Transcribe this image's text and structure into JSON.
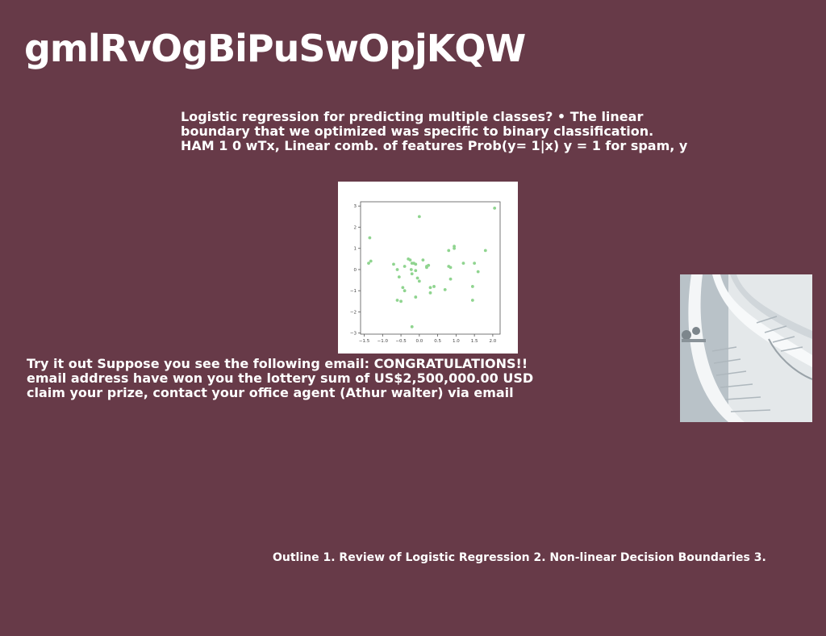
{
  "slide": {
    "title": "gmlRvOgBiPuSwOpjKQW",
    "paragraph_a": [
      "Logistic regression for predicting multiple classes? • The linear",
      "boundary that we optimized was specific to binary classification.",
      "HAM 1 0 wTx, Linear comb. of features Prob(y= 1|x) y = 1 for spam, y"
    ],
    "paragraph_b": [
      "Try it out Suppose you see the following email: CONGRATULATIONS!!",
      "email address have won you the lottery sum of US$2,500,000.00 USD",
      "claim your prize, contact your office agent (Athur walter) via email"
    ],
    "outline": "Outline 1. Review of Logistic Regression 2. Non-linear Decision Boundaries 3."
  },
  "colors": {
    "background": "#673a48",
    "text": "#ffffff",
    "scatter_point": "#8fd48f"
  },
  "chart_data": {
    "type": "scatter",
    "title": "",
    "xlabel": "",
    "ylabel": "",
    "xlim": [
      -1.6,
      2.2
    ],
    "ylim": [
      -3.05,
      3.2
    ],
    "xticks": [
      "−1.5",
      "−1.0",
      "−0.5",
      "0.0",
      "0.5",
      "1.0",
      "1.5",
      "2.0"
    ],
    "yticks": [
      "3",
      "2",
      "1",
      "0",
      "−1",
      "−2",
      "−3"
    ],
    "xtick_values": [
      -1.5,
      -1.0,
      -0.5,
      0.0,
      0.5,
      1.0,
      1.5,
      2.0
    ],
    "ytick_values": [
      3,
      2,
      1,
      0,
      -1,
      -2,
      -3
    ],
    "grid": false,
    "points": [
      [
        2.05,
        2.9
      ],
      [
        0.0,
        2.5
      ],
      [
        -1.35,
        1.5
      ],
      [
        0.95,
        1.1
      ],
      [
        0.95,
        1.0
      ],
      [
        0.8,
        0.9
      ],
      [
        1.8,
        0.9
      ],
      [
        -1.38,
        0.3
      ],
      [
        -1.32,
        0.4
      ],
      [
        -0.7,
        0.25
      ],
      [
        -0.6,
        0.0
      ],
      [
        -0.4,
        0.15
      ],
      [
        -0.3,
        0.5
      ],
      [
        -0.25,
        0.45
      ],
      [
        -0.2,
        0.3
      ],
      [
        -0.15,
        0.3
      ],
      [
        -0.1,
        0.25
      ],
      [
        -0.22,
        0.0
      ],
      [
        -0.2,
        -0.2
      ],
      [
        -0.1,
        -0.05
      ],
      [
        -0.05,
        -0.4
      ],
      [
        0.1,
        0.45
      ],
      [
        0.2,
        0.15
      ],
      [
        0.25,
        0.2
      ],
      [
        0.2,
        0.1
      ],
      [
        1.2,
        0.3
      ],
      [
        1.5,
        0.3
      ],
      [
        0.8,
        0.15
      ],
      [
        0.85,
        0.1
      ],
      [
        1.6,
        -0.1
      ],
      [
        0.0,
        -0.55
      ],
      [
        0.3,
        -0.85
      ],
      [
        0.4,
        -0.8
      ],
      [
        0.7,
        -0.95
      ],
      [
        0.85,
        -0.45
      ],
      [
        1.45,
        -0.8
      ],
      [
        -0.55,
        -0.35
      ],
      [
        -0.45,
        -0.85
      ],
      [
        -0.4,
        -1.0
      ],
      [
        -0.1,
        -1.3
      ],
      [
        0.3,
        -1.1
      ],
      [
        -0.6,
        -1.45
      ],
      [
        -0.5,
        -1.5
      ],
      [
        1.45,
        -1.45
      ],
      [
        -0.2,
        -2.7
      ]
    ]
  },
  "photo": {
    "subject": "white spiral staircase"
  }
}
